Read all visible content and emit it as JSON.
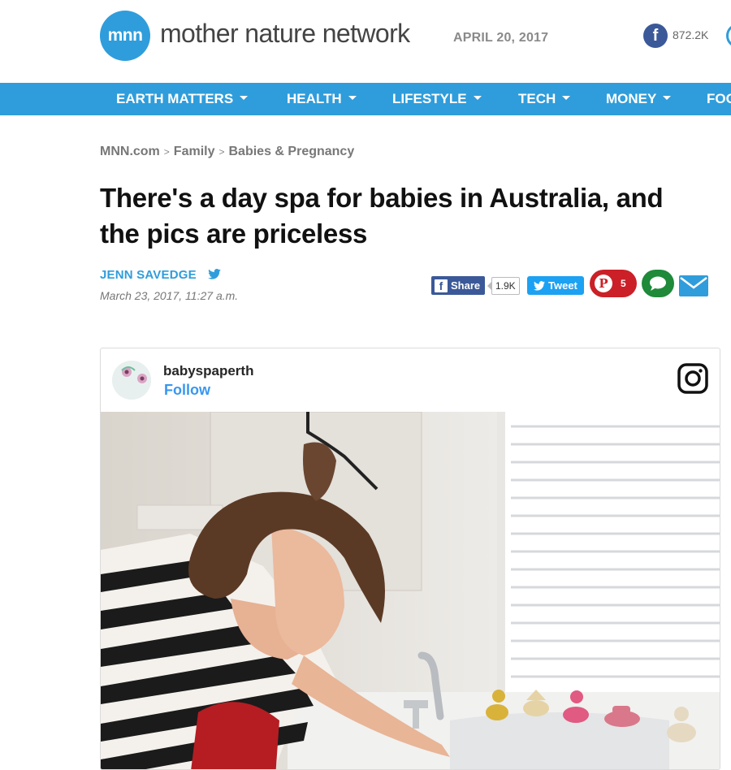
{
  "header": {
    "logo_text": "mnn",
    "site_name": "mother nature network",
    "date": "APRIL 20, 2017",
    "facebook_count": "872.2K"
  },
  "nav": {
    "items": [
      {
        "label": "EARTH MATTERS"
      },
      {
        "label": "HEALTH"
      },
      {
        "label": "LIFESTYLE"
      },
      {
        "label": "TECH"
      },
      {
        "label": "MONEY"
      },
      {
        "label": "FOOD"
      }
    ]
  },
  "breadcrumb": {
    "items": [
      "MNN.com",
      "Family",
      "Babies & Pregnancy"
    ],
    "separator": ">"
  },
  "article": {
    "title": "There's a day spa for babies in Australia, and the pics are priceless",
    "author": "JENN SAVEDGE",
    "date": "March 23, 2017, 11:27 a.m."
  },
  "share": {
    "facebook_label": "Share",
    "facebook_count": "1.9K",
    "twitter_label": "Tweet",
    "pinterest_count": "5"
  },
  "instagram": {
    "username": "babyspaperth",
    "follow_label": "Follow"
  },
  "colors": {
    "brand_blue": "#2f9ddb",
    "facebook": "#3b5998",
    "twitter": "#1da1f2",
    "pinterest": "#cb2027",
    "comments": "#1e8a3a",
    "instagram_link": "#3897f0"
  },
  "icons": [
    "facebook-icon",
    "twitter-icon",
    "pinterest-icon",
    "comment-icon",
    "mail-icon",
    "instagram-icon"
  ]
}
